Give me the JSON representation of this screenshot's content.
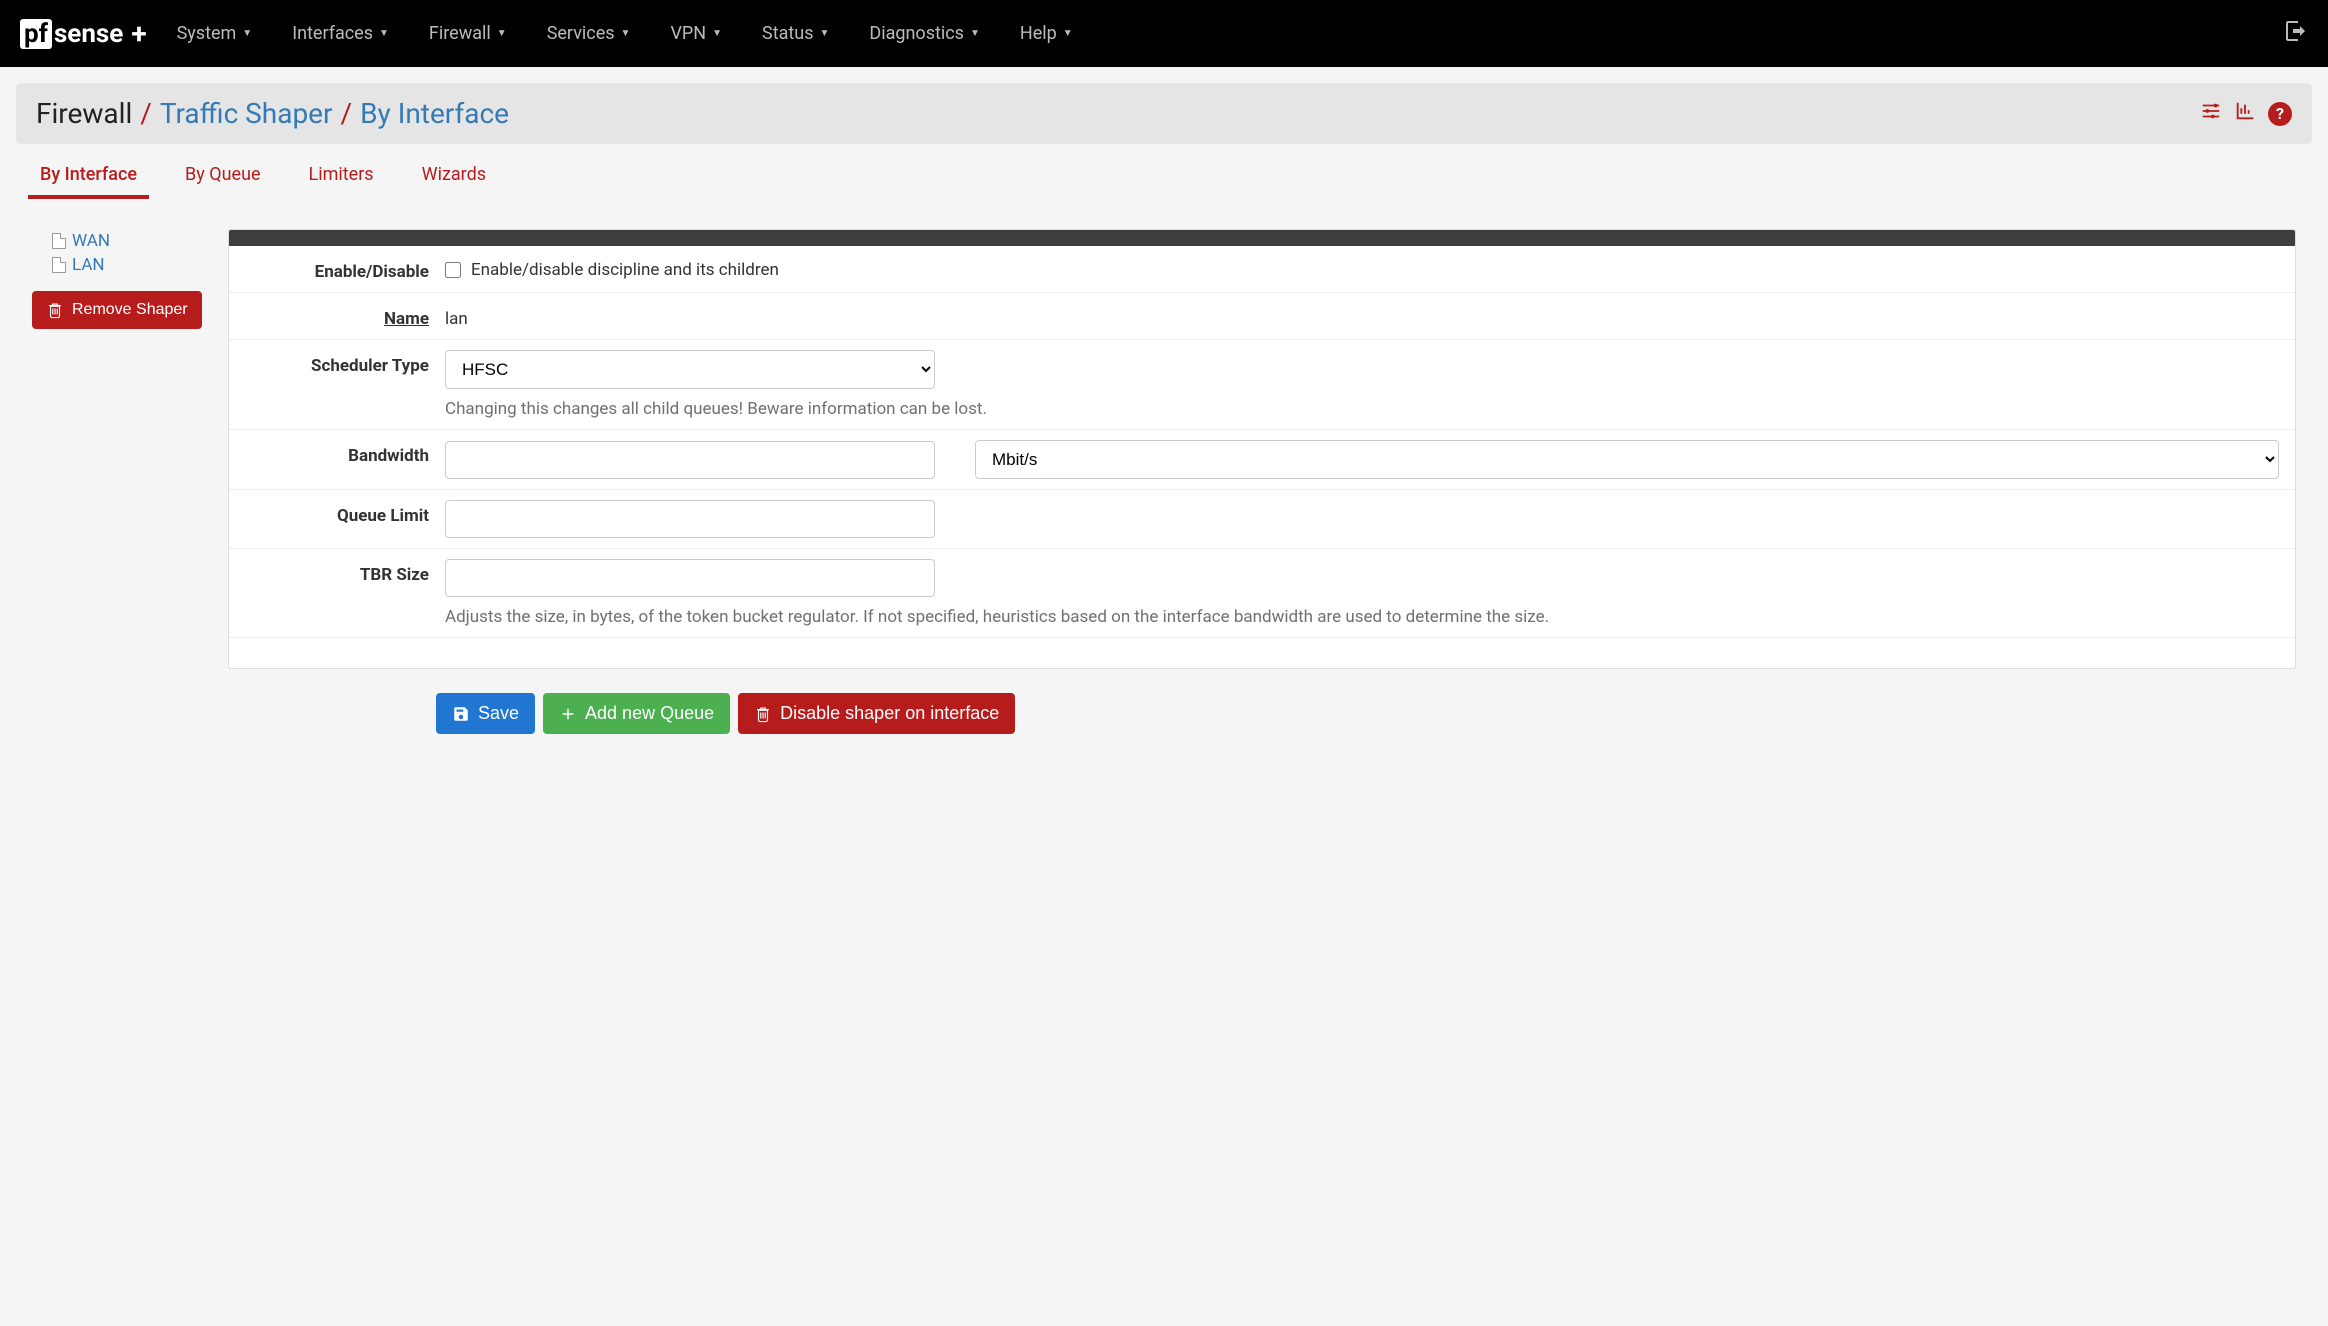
{
  "nav": {
    "items": [
      "System",
      "Interfaces",
      "Firewall",
      "Services",
      "VPN",
      "Status",
      "Diagnostics",
      "Help"
    ]
  },
  "breadcrumb": {
    "root": "Firewall",
    "mid": "Traffic Shaper",
    "leaf": "By Interface"
  },
  "tabs": [
    "By Interface",
    "By Queue",
    "Limiters",
    "Wizards"
  ],
  "sidebar": {
    "items": [
      "WAN",
      "LAN"
    ],
    "remove_label": "Remove Shaper"
  },
  "form": {
    "enable": {
      "label": "Enable/Disable",
      "checkbox_label": "Enable/disable discipline and its children",
      "checked": false
    },
    "name": {
      "label": "Name",
      "value": "lan"
    },
    "scheduler": {
      "label": "Scheduler Type",
      "value": "HFSC",
      "help": "Changing this changes all child queues! Beware information can be lost."
    },
    "bandwidth": {
      "label": "Bandwidth",
      "value": "",
      "unit": "Mbit/s"
    },
    "queue_limit": {
      "label": "Queue Limit",
      "value": ""
    },
    "tbr": {
      "label": "TBR Size",
      "value": "",
      "help": "Adjusts the size, in bytes, of the token bucket regulator. If not specified, heuristics based on the interface bandwidth are used to determine the size."
    }
  },
  "actions": {
    "save": "Save",
    "add_queue": "Add new Queue",
    "disable": "Disable shaper on interface"
  }
}
